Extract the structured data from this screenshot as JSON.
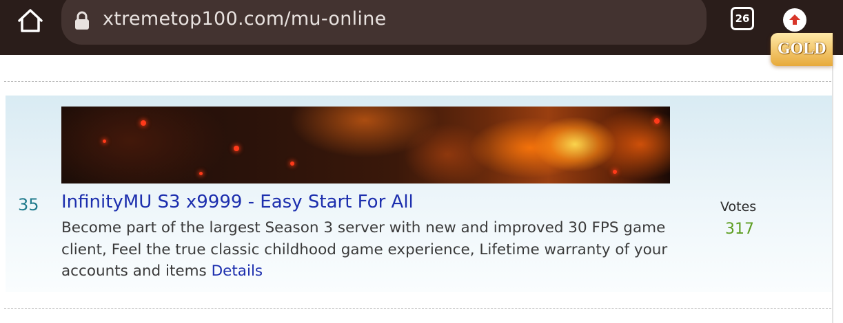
{
  "browser": {
    "url": "xtremetop100.com/mu-online",
    "tab_count": "26"
  },
  "listing": {
    "rank": "35",
    "title": "InfinityMU S3 x9999 - Easy Start For All",
    "description": "Become part of the largest Season 3 server with new and improved 30 FPS game client, Feel the true classic childhood game experience, Lifetime warranty of your accounts and items",
    "details_link": "Details",
    "votes_label": "Votes",
    "votes": "317",
    "banner_icon": "game-banner-image"
  },
  "side_logo": {
    "text": "GOLD"
  },
  "colors": {
    "toolbar": "#2a1d1a",
    "url_pill": "#433330",
    "title_link": "#1d2fae",
    "rank": "#1f7a8c",
    "votes_count": "#5d9e22",
    "listing_bg": "#d9ebf3"
  }
}
